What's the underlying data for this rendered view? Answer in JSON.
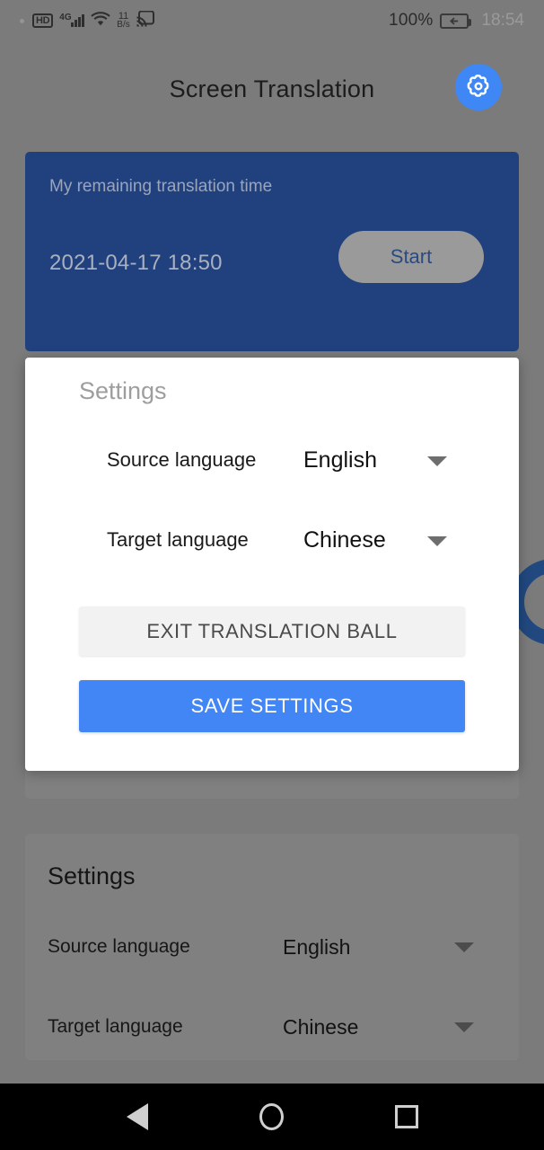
{
  "statusbar": {
    "hd_label": "HD",
    "network_label": "4G",
    "data_rate_value": "11",
    "data_rate_unit": "B/s",
    "battery_percent": "100%",
    "clock": "18:54",
    "icons": [
      "hd-icon",
      "signal-4g-icon",
      "wifi-icon",
      "data-rate-icon",
      "cast-icon",
      "battery-charging-icon"
    ]
  },
  "header": {
    "title": "Screen Translation",
    "settings_icon": "gear-icon"
  },
  "blue_card": {
    "label": "My remaining translation time",
    "datetime": "2021-04-17 18:50",
    "start_label": "Start",
    "bg_color": "#21417e",
    "start_bg_color": "#9a9a9a"
  },
  "floating_ball": {
    "name": "translation-ball",
    "color": "#21487f"
  },
  "dialog": {
    "title": "Settings",
    "rows": [
      {
        "label": "Source language",
        "value": "English",
        "arrow_icon": "chevron-down-icon"
      },
      {
        "label": "Target language",
        "value": "Chinese",
        "arrow_icon": "chevron-down-icon"
      }
    ],
    "exit_label": "EXIT TRANSLATION BALL",
    "save_label": "SAVE SETTINGS",
    "save_color": "#4285f4",
    "exit_color": "#f2f2f2"
  },
  "background_settings": {
    "title": "Settings",
    "rows": [
      {
        "label": "Source language",
        "value": "English",
        "arrow_icon": "chevron-down-icon"
      },
      {
        "label": "Target language",
        "value": "Chinese",
        "arrow_icon": "chevron-down-icon"
      }
    ]
  },
  "navbar": {
    "back": "back-icon",
    "home": "home-icon",
    "recents": "recents-icon"
  }
}
